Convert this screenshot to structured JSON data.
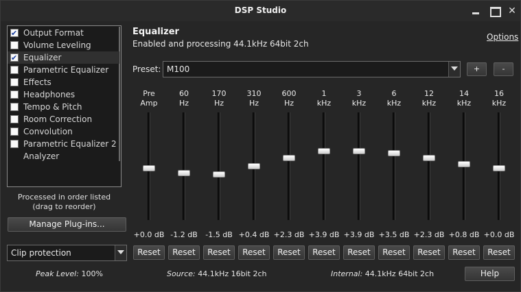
{
  "window": {
    "title": "DSP Studio"
  },
  "sidebar": {
    "plugins": [
      {
        "label": "Output Format",
        "checked": true,
        "has_checkbox": true
      },
      {
        "label": "Volume Leveling",
        "checked": false,
        "has_checkbox": true
      },
      {
        "label": "Equalizer",
        "checked": true,
        "has_checkbox": true,
        "selected": true
      },
      {
        "label": "Parametric Equalizer",
        "checked": false,
        "has_checkbox": true
      },
      {
        "label": "Effects",
        "checked": false,
        "has_checkbox": true
      },
      {
        "label": "Headphones",
        "checked": false,
        "has_checkbox": true
      },
      {
        "label": "Tempo & Pitch",
        "checked": false,
        "has_checkbox": true
      },
      {
        "label": "Room Correction",
        "checked": false,
        "has_checkbox": true
      },
      {
        "label": "Convolution",
        "checked": false,
        "has_checkbox": true
      },
      {
        "label": "Parametric Equalizer 2",
        "checked": false,
        "has_checkbox": true
      },
      {
        "label": "Analyzer",
        "checked": false,
        "has_checkbox": false
      }
    ],
    "order_note": "Processed in order listed (drag to reorder)",
    "manage_button": "Manage Plug-ins...",
    "clip_select": "Clip protection"
  },
  "status": {
    "peak_label": "Peak Level:",
    "peak_value": "100%",
    "source_label": "Source:",
    "source_value": "44.1kHz 16bit 2ch",
    "internal_label": "Internal:",
    "internal_value": "44.1kHz 64bit 2ch"
  },
  "main": {
    "title": "Equalizer",
    "subtitle": "Enabled and processing 44.1kHz 64bit 2ch",
    "options_link": "Options",
    "preset_label": "Preset:",
    "preset_value": "M100",
    "preset_add": "+",
    "preset_remove": "-",
    "reset_label": "Reset",
    "help_button": "Help",
    "slider_range_db": [
      -12,
      12
    ],
    "bands": [
      {
        "line1": "Pre",
        "line2": "Amp",
        "value_db": 0.0,
        "label": "+0.0 dB"
      },
      {
        "line1": "60",
        "line2": "Hz",
        "value_db": -1.2,
        "label": "-1.2 dB"
      },
      {
        "line1": "170",
        "line2": "Hz",
        "value_db": -1.5,
        "label": "-1.5 dB"
      },
      {
        "line1": "310",
        "line2": "Hz",
        "value_db": 0.4,
        "label": "+0.4 dB"
      },
      {
        "line1": "600",
        "line2": "Hz",
        "value_db": 2.3,
        "label": "+2.3 dB"
      },
      {
        "line1": "1",
        "line2": "kHz",
        "value_db": 3.9,
        "label": "+3.9 dB"
      },
      {
        "line1": "3",
        "line2": "kHz",
        "value_db": 3.9,
        "label": "+3.9 dB"
      },
      {
        "line1": "6",
        "line2": "kHz",
        "value_db": 3.5,
        "label": "+3.5 dB"
      },
      {
        "line1": "12",
        "line2": "kHz",
        "value_db": 2.3,
        "label": "+2.3 dB"
      },
      {
        "line1": "14",
        "line2": "kHz",
        "value_db": 0.8,
        "label": "+0.8 dB"
      },
      {
        "line1": "16",
        "line2": "kHz",
        "value_db": 0.0,
        "label": "+0.0 dB"
      }
    ]
  }
}
